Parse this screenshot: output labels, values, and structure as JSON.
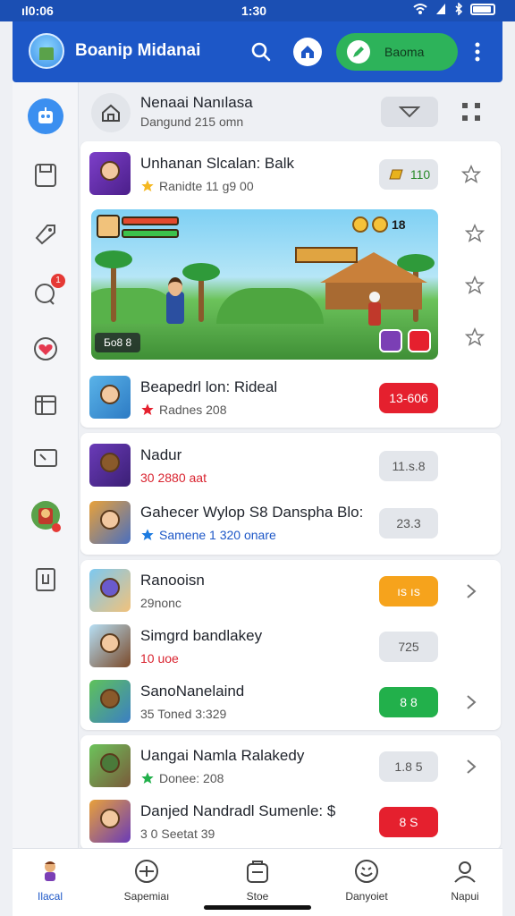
{
  "status_bar": {
    "time_left": "ıl0:06",
    "time_center": "1:30",
    "icons": [
      "wifi-icon",
      "signal-icon",
      "bluetooth-icon",
      "battery-icon"
    ]
  },
  "app_bar": {
    "title": "Boanip Midanai",
    "cta_label": "Baoma"
  },
  "sidebar": {
    "items": [
      {
        "icon": "robot-icon",
        "active": true
      },
      {
        "icon": "save-icon"
      },
      {
        "icon": "tag-icon"
      },
      {
        "icon": "chat-icon",
        "badge": "1"
      },
      {
        "icon": "heart-icon"
      },
      {
        "icon": "calendar-icon"
      },
      {
        "icon": "folder-icon"
      },
      {
        "icon": "game-character-icon"
      },
      {
        "icon": "exit-icon"
      }
    ]
  },
  "header": {
    "title": "Nenaai Nanılasa",
    "subtitle": "Dangund 215 omn"
  },
  "featured": {
    "row": {
      "title": "Unhanan Slcalan: Balk",
      "subtitle": "Ranidte 11 g9 00",
      "pill": "110"
    },
    "banner": {
      "coin_text": "18",
      "hud_text": "Бо8 8"
    },
    "row2": {
      "title": "Beapedrl lon: Rideal",
      "subtitle": "Radnes 208",
      "pill": "13-606"
    }
  },
  "list2": [
    {
      "title": "Nadur",
      "subtitle": "30 2880 aat",
      "pill": "11.s.8"
    },
    {
      "title": "Gahecer Wylop S8 Danspha Blo:",
      "subtitle": "Samene 1 320 onare",
      "pill": "23.3"
    }
  ],
  "list3": [
    {
      "title": "Ranooisn",
      "subtitle": "29nonc",
      "pill": "ıs ıs",
      "pill_style": "orange",
      "chevron": true
    },
    {
      "title": "Simgrd bandlakey",
      "subtitle": "10 uoe",
      "pill": "725",
      "pill_style": "grey",
      "chevron": false
    },
    {
      "title": "SanoNanelaind",
      "subtitle": "35 Toned 3:329",
      "pill": "8 8",
      "pill_style": "green",
      "chevron": true
    }
  ],
  "list4": [
    {
      "title": "Uangai Namla Ralakedy",
      "subtitle": "Donee: 208",
      "pill": "1.8 5",
      "pill_style": "grey",
      "chevron": true
    },
    {
      "title": "Danjed Nandradl Sumenle: $",
      "subtitle": "3 0 Seetat 39",
      "pill": "8 S",
      "pill_style": "red",
      "chevron": false
    }
  ],
  "bottom_nav": [
    {
      "label": "Ilacal",
      "icon": "character-icon",
      "active": true
    },
    {
      "label": "Sapemiaı",
      "icon": "compass-icon"
    },
    {
      "label": "Stoe",
      "icon": "store-icon"
    },
    {
      "label": "Danyoiet",
      "icon": "emoji-icon"
    },
    {
      "label": "Napui",
      "icon": "profile-icon"
    }
  ],
  "colors": {
    "brand": "#1d57c7",
    "accent_green": "#2db35a",
    "red": "#e5202e",
    "orange": "#f6a31c",
    "green": "#22b04b"
  }
}
